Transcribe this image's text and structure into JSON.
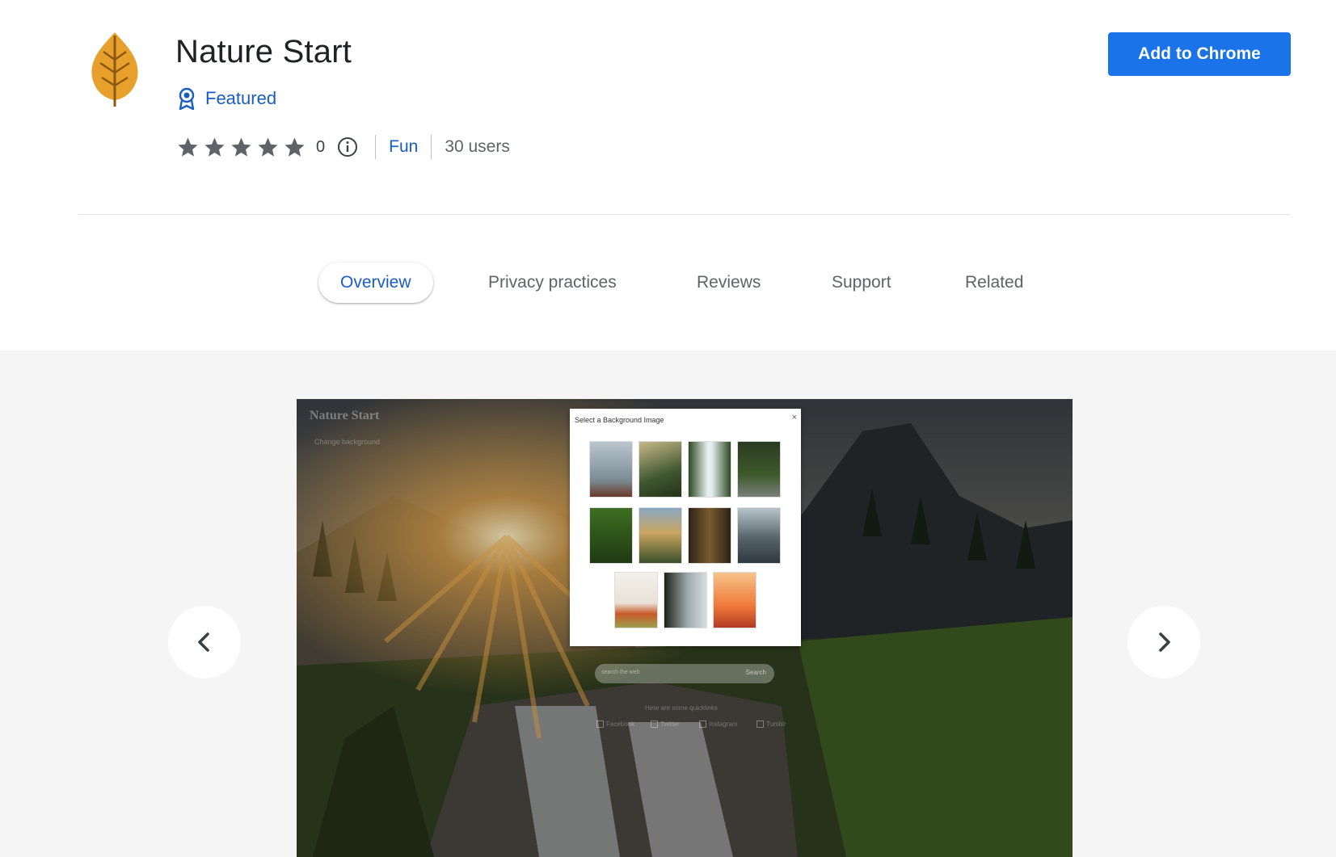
{
  "extension": {
    "title": "Nature Start",
    "featured_label": "Featured",
    "rating": "0",
    "category": "Fun",
    "users": "30 users",
    "add_button_label": "Add to Chrome"
  },
  "tabs": [
    {
      "label": "Overview",
      "active": true
    },
    {
      "label": "Privacy practices"
    },
    {
      "label": "Reviews"
    },
    {
      "label": "Support"
    },
    {
      "label": "Related"
    }
  ],
  "screenshot": {
    "brand": "Nature Start",
    "subtitle": "Change background",
    "dialog_title": "Select a Background Image",
    "dialog_close": "×",
    "search_placeholder": "search the web",
    "search_button": "Search",
    "quicklinks_label": "Here are some quicklinks",
    "social": [
      "Facebook",
      "Twitter",
      "Instagram",
      "Tumblr"
    ]
  },
  "colors": {
    "brand_blue": "#1a73e8",
    "link_blue": "#1a5dc2",
    "star_gray": "#5f6368",
    "leaf_orange": "#e8a02c"
  }
}
